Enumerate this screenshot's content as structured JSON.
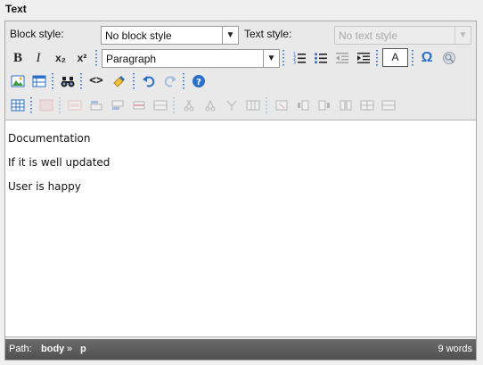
{
  "field_label": "Text",
  "toolbar": {
    "block_style_label": "Block style:",
    "block_style_value": "No block style",
    "text_style_label": "Text style:",
    "text_style_value": "No text style",
    "format_value": "Paragraph",
    "bold": "B",
    "italic": "I",
    "subscript": "x₂",
    "superscript": "x²",
    "text_color": "A",
    "special_char": "Ω",
    "source_code": "<>",
    "accent_color": "#2a6fc9"
  },
  "content": {
    "paragraphs": [
      "Documentation",
      "If it is well updated",
      "User is happy"
    ]
  },
  "statusbar": {
    "path_label": "Path:",
    "path_body": "body",
    "path_sep": "»",
    "path_p": "p",
    "word_count": "9 words"
  }
}
